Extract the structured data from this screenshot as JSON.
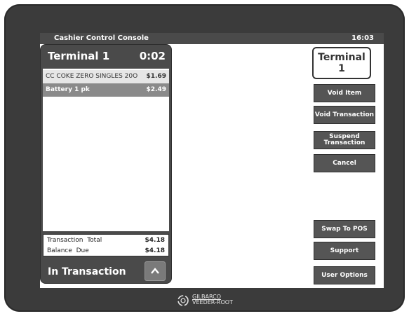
{
  "window": {
    "title": "Cashier Control Console",
    "clock": "16:03"
  },
  "panel": {
    "terminal": "Terminal 1",
    "timer": "0:02",
    "items": [
      {
        "name": "CC COKE ZERO SINGLES 20O",
        "price": "$1.69"
      },
      {
        "name": "Battery 1 pk",
        "price": "$2.49"
      }
    ],
    "totals": {
      "total_label": "Transaction  Total",
      "total_value": "$4.18",
      "balance_label": "Balance  Due",
      "balance_value": "$4.18"
    },
    "status": "In Transaction",
    "up_icon": "chevron-up-icon"
  },
  "terminal_box": {
    "line1": "Terminal",
    "line2": "1"
  },
  "buttons": {
    "void_item": "Void Item",
    "void_transaction": "Void Transaction",
    "suspend_line1": "Suspend",
    "suspend_line2": "Transaction",
    "cancel": "Cancel",
    "swap_to_pos": "Swap To POS",
    "support": "Support",
    "user_options": "User Options"
  },
  "logo": {
    "line1": "GILBARCO",
    "line2": "VEEDER-ROOT",
    "icon": "gilbarco-logo-icon"
  },
  "colors": {
    "bezel": "#3b3b3b",
    "panel": "#4a4a4a",
    "button": "#555555",
    "selected_row": "#8a8a8a"
  }
}
